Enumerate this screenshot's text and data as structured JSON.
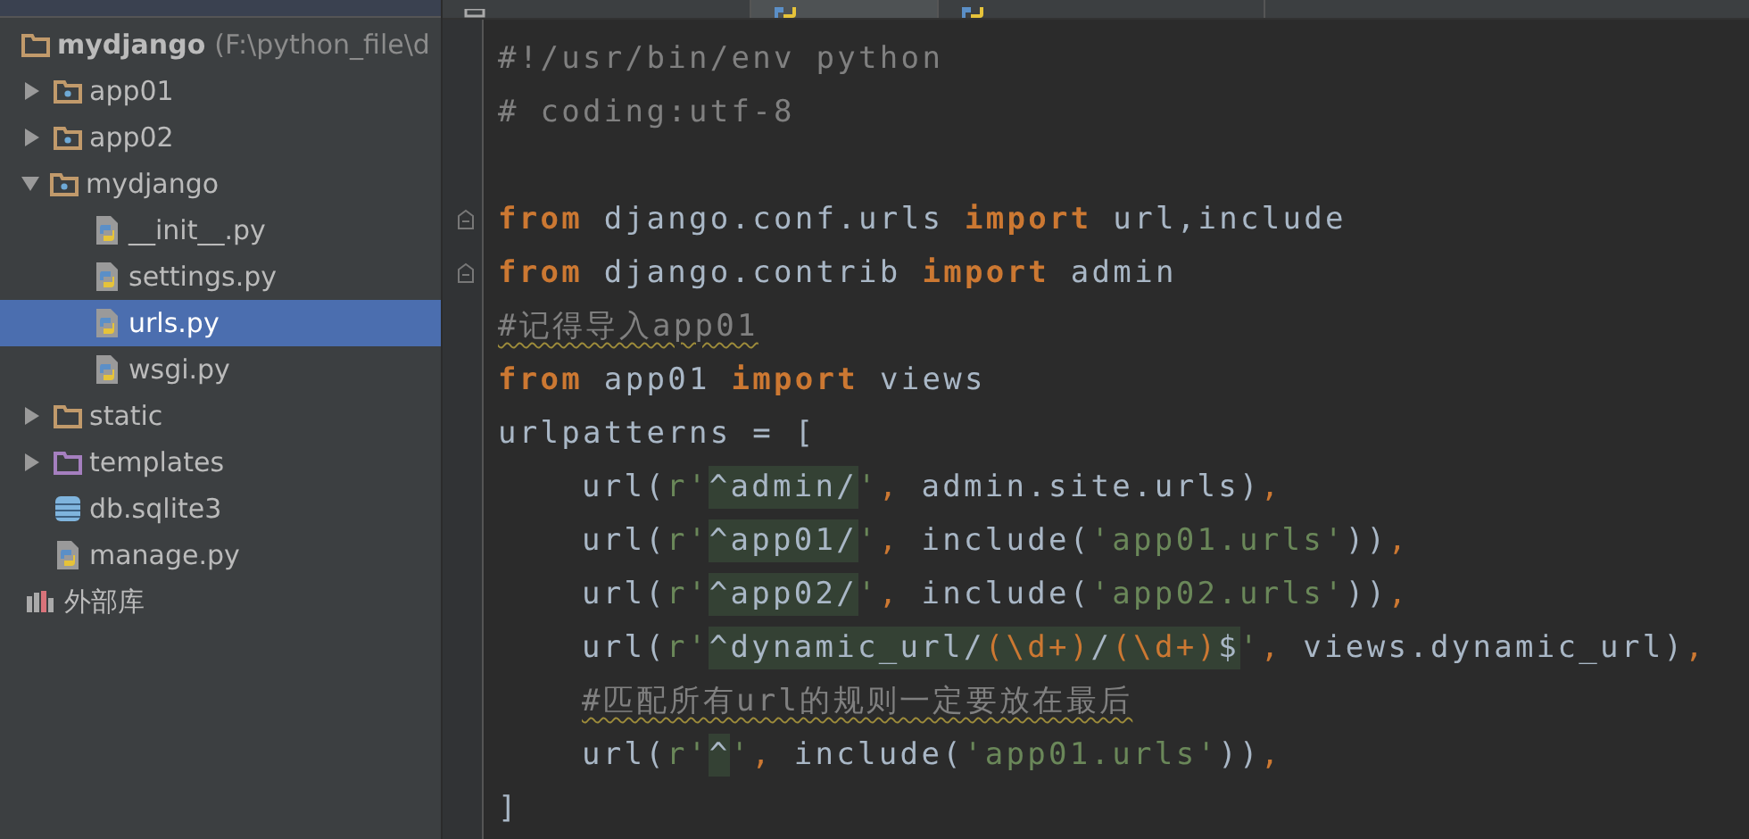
{
  "project_tree": {
    "root": {
      "name": "mydjango",
      "path": "(F:\\python_file\\d",
      "kind": "folder"
    },
    "items": [
      {
        "name": "app01",
        "kind": "package",
        "expanded": false,
        "selected": false
      },
      {
        "name": "app02",
        "kind": "package",
        "expanded": false,
        "selected": false
      },
      {
        "name": "mydjango",
        "kind": "package",
        "expanded": true,
        "selected": false,
        "children": [
          {
            "name": "__init__.py",
            "kind": "python",
            "selected": false
          },
          {
            "name": "settings.py",
            "kind": "python",
            "selected": false
          },
          {
            "name": "urls.py",
            "kind": "python",
            "selected": true
          },
          {
            "name": "wsgi.py",
            "kind": "python",
            "selected": false
          }
        ]
      },
      {
        "name": "static",
        "kind": "folder",
        "expanded": false,
        "selected": false
      },
      {
        "name": "templates",
        "kind": "templates",
        "expanded": false,
        "selected": false
      },
      {
        "name": "db.sqlite3",
        "kind": "database",
        "selected": false
      },
      {
        "name": "manage.py",
        "kind": "python",
        "selected": false
      }
    ],
    "libraries": {
      "name": "外部库",
      "kind": "library"
    }
  },
  "editor_tabs": [
    {
      "kind": "html",
      "selected": false
    },
    {
      "kind": "python",
      "selected": true
    },
    {
      "kind": "python",
      "selected": false
    }
  ],
  "code_lines": [
    {
      "tokens": [
        {
          "kind": "comment",
          "text": "#!/usr/bin/env python"
        }
      ]
    },
    {
      "tokens": [
        {
          "kind": "comment",
          "text": "# coding:utf-8"
        }
      ]
    },
    {
      "kind": "blank"
    },
    {
      "fold": true,
      "tokens": [
        {
          "kind": "keyword",
          "text": "from"
        },
        {
          "kind": "plain",
          "text": " django.conf.urls "
        },
        {
          "kind": "keyword",
          "text": "import"
        },
        {
          "kind": "plain",
          "text": " url,include"
        }
      ]
    },
    {
      "fold": true,
      "tokens": [
        {
          "kind": "keyword",
          "text": "from"
        },
        {
          "kind": "plain",
          "text": " django.contrib "
        },
        {
          "kind": "keyword",
          "text": "import"
        },
        {
          "kind": "plain",
          "text": " admin"
        }
      ]
    },
    {
      "tokens": [
        {
          "kind": "comment",
          "text": "#记得导入app01",
          "warning": true
        }
      ]
    },
    {
      "tokens": [
        {
          "kind": "keyword",
          "text": "from"
        },
        {
          "kind": "plain",
          "text": " app01 "
        },
        {
          "kind": "keyword",
          "text": "import"
        },
        {
          "kind": "plain",
          "text": " views"
        }
      ]
    },
    {
      "tokens": [
        {
          "kind": "plain",
          "text": "urlpatterns = ["
        }
      ]
    },
    {
      "indented": true,
      "tokens": [
        {
          "kind": "plain",
          "text": "url("
        },
        {
          "kind": "string",
          "text": "r'"
        },
        {
          "kind": "plain",
          "text": "^admin/",
          "highlight": true
        },
        {
          "kind": "string",
          "text": "'"
        },
        {
          "kind": "punct",
          "text": ","
        },
        {
          "kind": "plain",
          "text": " admin.site.urls)"
        },
        {
          "kind": "punct",
          "text": ","
        }
      ]
    },
    {
      "indented": true,
      "tokens": [
        {
          "kind": "plain",
          "text": "url("
        },
        {
          "kind": "string",
          "text": "r'"
        },
        {
          "kind": "plain",
          "text": "^app01/",
          "highlight": true
        },
        {
          "kind": "string",
          "text": "'"
        },
        {
          "kind": "punct",
          "text": ","
        },
        {
          "kind": "plain",
          "text": " include("
        },
        {
          "kind": "string",
          "text": "'app01.urls'"
        },
        {
          "kind": "plain",
          "text": "))"
        },
        {
          "kind": "punct",
          "text": ","
        }
      ]
    },
    {
      "indented": true,
      "tokens": [
        {
          "kind": "plain",
          "text": "url("
        },
        {
          "kind": "string",
          "text": "r'"
        },
        {
          "kind": "plain",
          "text": "^app02/",
          "highlight": true
        },
        {
          "kind": "string",
          "text": "'"
        },
        {
          "kind": "punct",
          "text": ","
        },
        {
          "kind": "plain",
          "text": " include("
        },
        {
          "kind": "string",
          "text": "'app02.urls'"
        },
        {
          "kind": "plain",
          "text": "))"
        },
        {
          "kind": "punct",
          "text": ","
        }
      ]
    },
    {
      "indented": true,
      "tokens": [
        {
          "kind": "plain",
          "text": "url("
        },
        {
          "kind": "string",
          "text": "r'"
        },
        {
          "kind": "plain",
          "text": "^dynamic_url/",
          "highlight": true
        },
        {
          "kind": "punct",
          "text": "(\\d+)",
          "highlight": true
        },
        {
          "kind": "plain",
          "text": "/",
          "highlight": true
        },
        {
          "kind": "punct",
          "text": "(\\d+)",
          "highlight": true
        },
        {
          "kind": "plain",
          "text": "$",
          "highlight": true
        },
        {
          "kind": "string",
          "text": "'"
        },
        {
          "kind": "punct",
          "text": ","
        },
        {
          "kind": "plain",
          "text": " views.dynamic_url)"
        },
        {
          "kind": "punct",
          "text": ","
        }
      ]
    },
    {
      "indented": true,
      "tokens": [
        {
          "kind": "comment",
          "text": "#匹配所有url的规则一定要放在最后",
          "warning": true
        }
      ]
    },
    {
      "indented": true,
      "tokens": [
        {
          "kind": "plain",
          "text": "url("
        },
        {
          "kind": "string",
          "text": "r'"
        },
        {
          "kind": "plain",
          "text": "^",
          "highlight": true
        },
        {
          "kind": "string",
          "text": "'"
        },
        {
          "kind": "punct",
          "text": ","
        },
        {
          "kind": "plain",
          "text": " include("
        },
        {
          "kind": "string",
          "text": "'app01.urls'"
        },
        {
          "kind": "plain",
          "text": "))"
        },
        {
          "kind": "punct",
          "text": ","
        }
      ]
    },
    {
      "tokens": [
        {
          "kind": "plain",
          "text": "]"
        }
      ]
    }
  ]
}
